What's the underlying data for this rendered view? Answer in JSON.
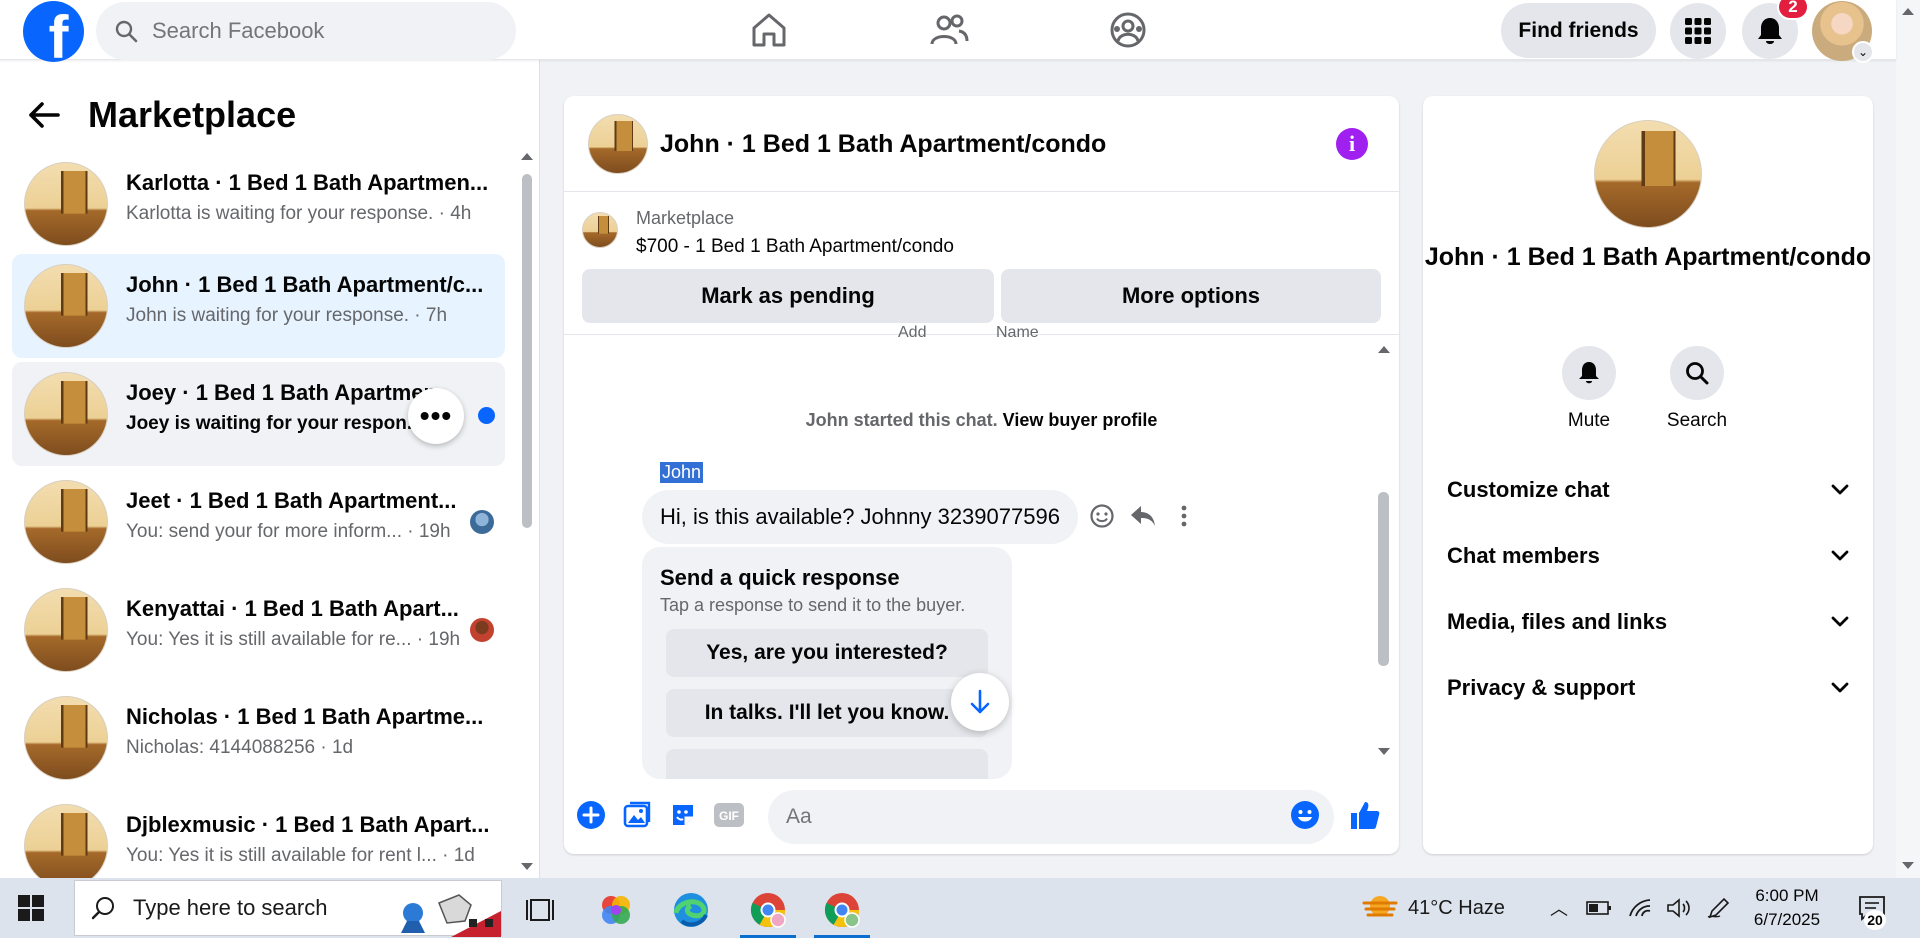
{
  "topbar": {
    "logo": "f",
    "search_placeholder": "Search Facebook",
    "find_friends": "Find friends",
    "notification_count": "2",
    "nav_icons": [
      "home-icon",
      "friends-icon",
      "groups-icon"
    ]
  },
  "left_panel": {
    "title": "Marketplace",
    "conversations": [
      {
        "name": "Karlotta · 1 Bed 1 Bath Apartmen...",
        "preview": "Karlotta is waiting for your response. · 4h",
        "state": "normal"
      },
      {
        "name": "John · 1 Bed 1 Bath Apartment/c...",
        "preview": "John is waiting for your response. · 7h",
        "state": "selected"
      },
      {
        "name": "Joey · 1 Bed 1 Bath Apartmen",
        "preview": "Joey is waiting for your respon...",
        "state": "unread-hover"
      },
      {
        "name": "Jeet · 1 Bed 1 Bath Apartment...",
        "preview": "You: send your for more inform... · 19h",
        "state": "normal"
      },
      {
        "name": "Kenyattai · 1 Bed 1 Bath Apart...",
        "preview": "You: Yes it is still available for re... · 19h",
        "state": "normal"
      },
      {
        "name": "Nicholas · 1 Bed 1 Bath Apartme...",
        "preview": "Nicholas: 4144088256 · 1d",
        "state": "normal"
      },
      {
        "name": "Djblexmusic · 1 Bed 1 Bath Apart...",
        "preview": "You: Yes it is still available for rent l... · 1d",
        "state": "normal"
      }
    ]
  },
  "chat": {
    "title": "John · 1 Bed 1 Bath Apartment/condo",
    "listing_source": "Marketplace",
    "listing_price": "$700 - 1 Bed 1 Bath Apartment/condo",
    "mark_pending": "Mark as pending",
    "more_options": "More options",
    "ghost_left": "Add",
    "ghost_right": "Name",
    "started_text": "John started this chat.",
    "view_profile": "View buyer profile",
    "sender": "John",
    "message": "Hi, is this available? Johnny 3239077596",
    "quick_response_title": "Send a quick response",
    "quick_response_sub": "Tap a response to send it to the buyer.",
    "quick_responses": [
      "Yes, are you interested?",
      "In talks. I'll let you know."
    ],
    "composer_placeholder": "Aa",
    "gif_label": "GIF"
  },
  "details": {
    "name": "John · 1 Bed 1 Bath Apartment/condo",
    "mute": "Mute",
    "search": "Search",
    "sections": [
      "Customize chat",
      "Chat members",
      "Media, files and links",
      "Privacy & support"
    ]
  },
  "taskbar": {
    "search_placeholder": "Type here to search",
    "weather": "41°C  Haze",
    "time": "6:00 PM",
    "date": "6/7/2025",
    "notifications": "20"
  },
  "colors": {
    "facebook_blue": "#0866ff",
    "selected_row": "#e7f3ff",
    "info_purple": "#a020f0",
    "badge_red": "#e41e3f"
  }
}
